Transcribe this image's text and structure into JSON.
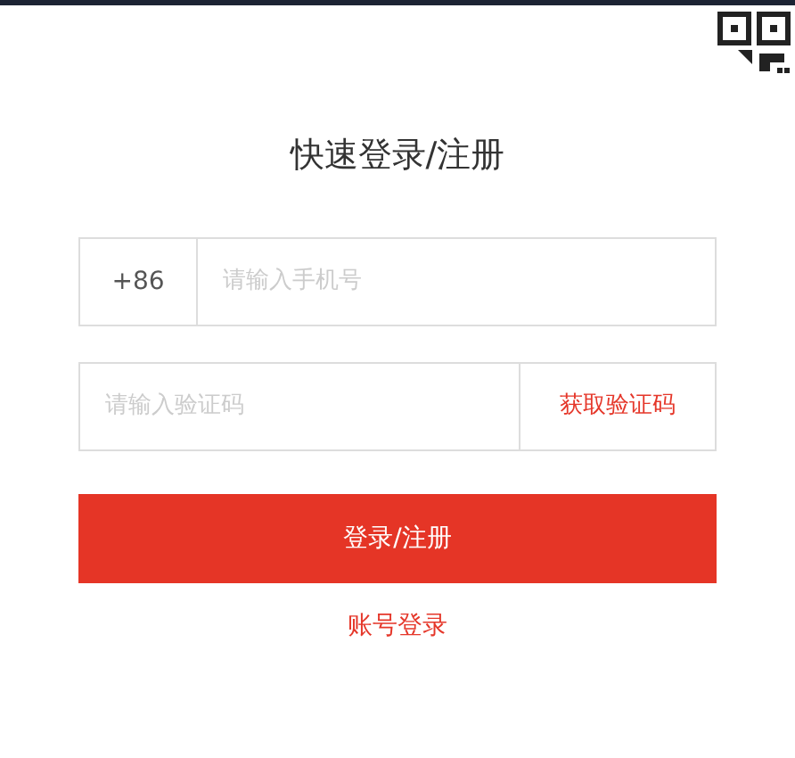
{
  "title": "快速登录/注册",
  "phone": {
    "country_code": "+86",
    "placeholder": "请输入手机号"
  },
  "code": {
    "placeholder": "请输入验证码",
    "send_button": "获取验证码"
  },
  "submit_button": "登录/注册",
  "account_login_link": "账号登录"
}
